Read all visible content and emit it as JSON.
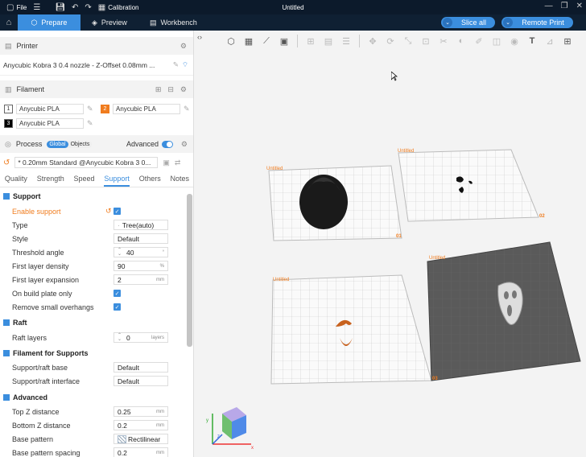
{
  "titlebar": {
    "file": "File",
    "calibration": "Calibration",
    "title": "Untitled"
  },
  "tabs": [
    {
      "label": "Prepare"
    },
    {
      "label": "Preview"
    },
    {
      "label": "Workbench"
    }
  ],
  "actions": {
    "slice_all": "Slice all",
    "remote_print": "Remote Print"
  },
  "printer": {
    "header": "Printer",
    "value": "Anycubic Kobra 3 0.4 nozzle - Z-Offset 0.08mm ..."
  },
  "filament": {
    "header": "Filament",
    "items": [
      {
        "num": "1",
        "name": "Anycubic PLA",
        "color": "#ffffff"
      },
      {
        "num": "2",
        "name": "Anycubic PLA",
        "color": "#f07c1e"
      },
      {
        "num": "3",
        "name": "Anycubic PLA",
        "color": "#000000"
      }
    ]
  },
  "process": {
    "header": "Process",
    "global": "Global",
    "objects": "Objects",
    "advanced": "Advanced",
    "preset": "* 0.20mm Standard @Anycubic Kobra 3 0..."
  },
  "subtabs": [
    "Quality",
    "Strength",
    "Speed",
    "Support",
    "Others",
    "Notes"
  ],
  "support": {
    "header": "Support",
    "rows": [
      {
        "label": "Enable support",
        "type": "check"
      },
      {
        "label": "Type",
        "value": "Tree(auto)"
      },
      {
        "label": "Style",
        "value": "Default"
      },
      {
        "label": "Threshold angle",
        "value": "40",
        "unit": "°"
      },
      {
        "label": "First layer density",
        "value": "90",
        "unit": "%"
      },
      {
        "label": "First layer expansion",
        "value": "2",
        "unit": "mm"
      },
      {
        "label": "On build plate only",
        "type": "check"
      },
      {
        "label": "Remove small overhangs",
        "type": "check"
      }
    ]
  },
  "raft": {
    "header": "Raft",
    "rows": [
      {
        "label": "Raft layers",
        "value": "0",
        "unit": "layers"
      }
    ]
  },
  "filament_supports": {
    "header": "Filament for Supports",
    "rows": [
      {
        "label": "Support/raft base",
        "value": "Default"
      },
      {
        "label": "Support/raft interface",
        "value": "Default"
      }
    ]
  },
  "advanced": {
    "header": "Advanced",
    "rows": [
      {
        "label": "Top Z distance",
        "value": "0.25",
        "unit": "mm"
      },
      {
        "label": "Bottom Z distance",
        "value": "0.2",
        "unit": "mm"
      },
      {
        "label": "Base pattern",
        "value": "Rectilinear"
      },
      {
        "label": "Base pattern spacing",
        "value": "0.2",
        "unit": "mm"
      }
    ]
  },
  "plates": [
    {
      "label": "Untitled",
      "num": "01"
    },
    {
      "label": "Untitled",
      "num": "02"
    },
    {
      "label": "Untitled",
      "num": "03"
    },
    {
      "label": "Untitled",
      "num": "04"
    }
  ],
  "axes": {
    "x": "x",
    "y": "y",
    "z": "z"
  },
  "colors": {
    "accent": "#3b8ede",
    "orange": "#f07c1e",
    "titlebar": "#0c1a2b"
  }
}
